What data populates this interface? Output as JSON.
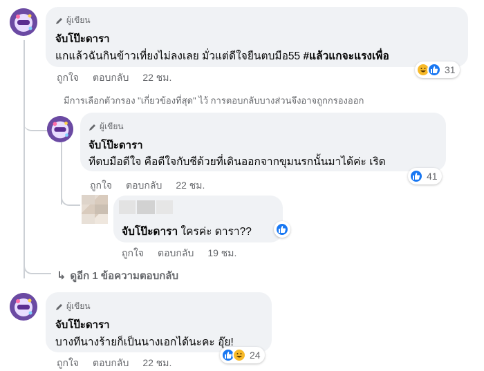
{
  "author_badge": "ผู้เขียน",
  "comments": [
    {
      "name": "จับโป๊ะดารา",
      "text": "แกแล้วฉันกินข้าวเที่ยงไม่ลงเลย มั่วแต่ดีใจยืนตบมือ55 ",
      "hashtag": "#แล้วแกจะแรงเพื่อ",
      "like_label": "ถูกใจ",
      "reply_label": "ตอบกลับ",
      "time": "22 ชม.",
      "reaction_count": "31",
      "reaction_icons": [
        "haha-icon",
        "like-icon"
      ]
    },
    {
      "name": "จับโป๊ะดารา",
      "text": "ทีตบมือดีใจ คือดีใจกับชีด้วยที่เดินออกจากขุมนรกนั้นมาได้ค่ะ เริด",
      "like_label": "ถูกใจ",
      "reply_label": "ตอบกลับ",
      "time": "22 ชม.",
      "reaction_count": "41",
      "reaction_icons": [
        "like-icon"
      ]
    },
    {
      "name": "จับโป๊ะดารา",
      "text": "ใครค่ะ ดารา??",
      "like_label": "ถูกใจ",
      "reply_label": "ตอบกลับ",
      "time": "19 ชม.",
      "reaction_icons": [
        "like-icon"
      ]
    },
    {
      "name": "จับโป๊ะดารา",
      "text": "บางทีนางร้ายก็เป็นนางเอกได้นะคะ อุ๊ย!",
      "like_label": "ถูกใจ",
      "reply_label": "ตอบกลับ",
      "time": "22 ชม.",
      "reaction_count": "24",
      "reaction_icons": [
        "like-icon",
        "haha-icon"
      ]
    }
  ],
  "filter_note": "มีการเลือกตัวกรอง \"เกี่ยวข้องที่สุด\" ไว้ การตอบกลับบางส่วนจึงอาจถูกกรองออก",
  "more_replies": "ดูอีก 1 ข้อความตอบกลับ",
  "colors": {
    "bubble": "#f0f2f5",
    "meta_text": "#65676b",
    "like_blue": "#1877f2",
    "haha_yellow": "#f7b928",
    "thread_line": "#ccd0d5"
  }
}
